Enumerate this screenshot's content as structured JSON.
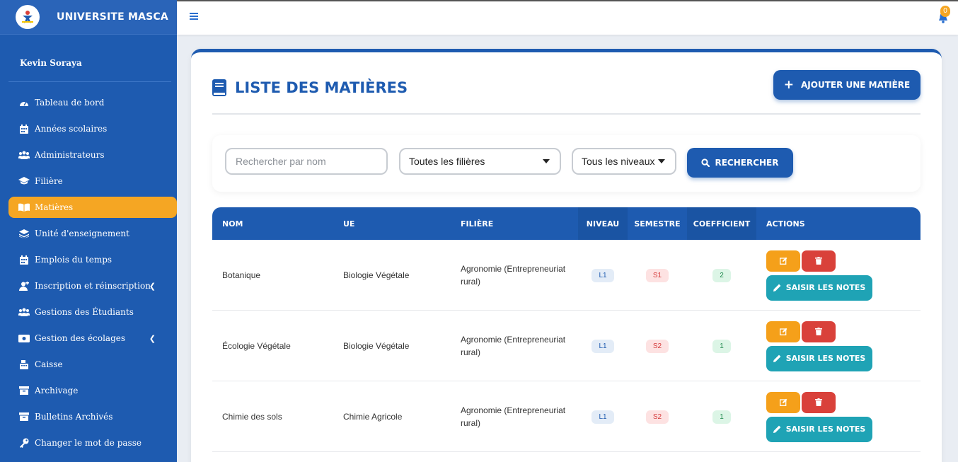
{
  "sidebar": {
    "brand": "UNIVERSITE MASCA",
    "user": "Kevin Soraya",
    "items": [
      {
        "label": "Tableau de bord",
        "icon": "dashboard-icon"
      },
      {
        "label": "Années scolaires",
        "icon": "calendar-icon"
      },
      {
        "label": "Administrateurs",
        "icon": "users-icon"
      },
      {
        "label": "Filière",
        "icon": "graduation-cap-icon"
      },
      {
        "label": "Matières",
        "icon": "book-open-icon",
        "active": true
      },
      {
        "label": "Unité d'enseignement",
        "icon": "layers-icon"
      },
      {
        "label": "Emplois du temps",
        "icon": "calendar-icon"
      },
      {
        "label": "Inscription et réinscription",
        "icon": "user-plus-icon",
        "has_submenu": true
      },
      {
        "label": "Gestions des Étudiants",
        "icon": "users-icon"
      },
      {
        "label": "Gestion des écolages",
        "icon": "money-icon",
        "has_submenu": true
      },
      {
        "label": "Caisse",
        "icon": "cash-register-icon"
      },
      {
        "label": "Archivage",
        "icon": "archive-icon"
      },
      {
        "label": "Bulletins Archivés",
        "icon": "archive-icon"
      },
      {
        "label": "Changer le mot de passe",
        "icon": "key-icon"
      }
    ]
  },
  "topbar": {
    "notification_count": "0"
  },
  "main": {
    "title": "LISTE DES MATIÈRES",
    "add_button": "AJOUTER UNE MATIÈRE",
    "filters": {
      "search_placeholder": "Rechercher par nom",
      "filiere_selected": "Toutes les filières",
      "niveau_selected": "Tous les niveaux",
      "search_button": "RECHERCHER"
    },
    "table": {
      "headers": [
        "NOM",
        "UE",
        "FILIÈRE",
        "NIVEAU",
        "SEMESTRE",
        "COEFFICIENT",
        "ACTIONS"
      ],
      "notes_button": "SAISIR LES NOTES",
      "rows": [
        {
          "nom": "Botanique",
          "ue": "Biologie Végétale",
          "filiere": "Agronomie (Entrepreneuriat rural)",
          "niveau": "L1",
          "semestre": "S1",
          "coefficient": "2"
        },
        {
          "nom": "Écologie Végétale",
          "ue": "Biologie Végétale",
          "filiere": "Agronomie (Entrepreneuriat rural)",
          "niveau": "L1",
          "semestre": "S2",
          "coefficient": "1"
        },
        {
          "nom": "Chimie des sols",
          "ue": "Chimie Agricole",
          "filiere": "Agronomie (Entrepreneuriat rural)",
          "niveau": "L1",
          "semestre": "S2",
          "coefficient": "1"
        }
      ]
    }
  },
  "colors": {
    "primary": "#1e5bb0",
    "accent": "#f5a623",
    "danger": "#d9413a",
    "teal": "#1fa3b5"
  }
}
